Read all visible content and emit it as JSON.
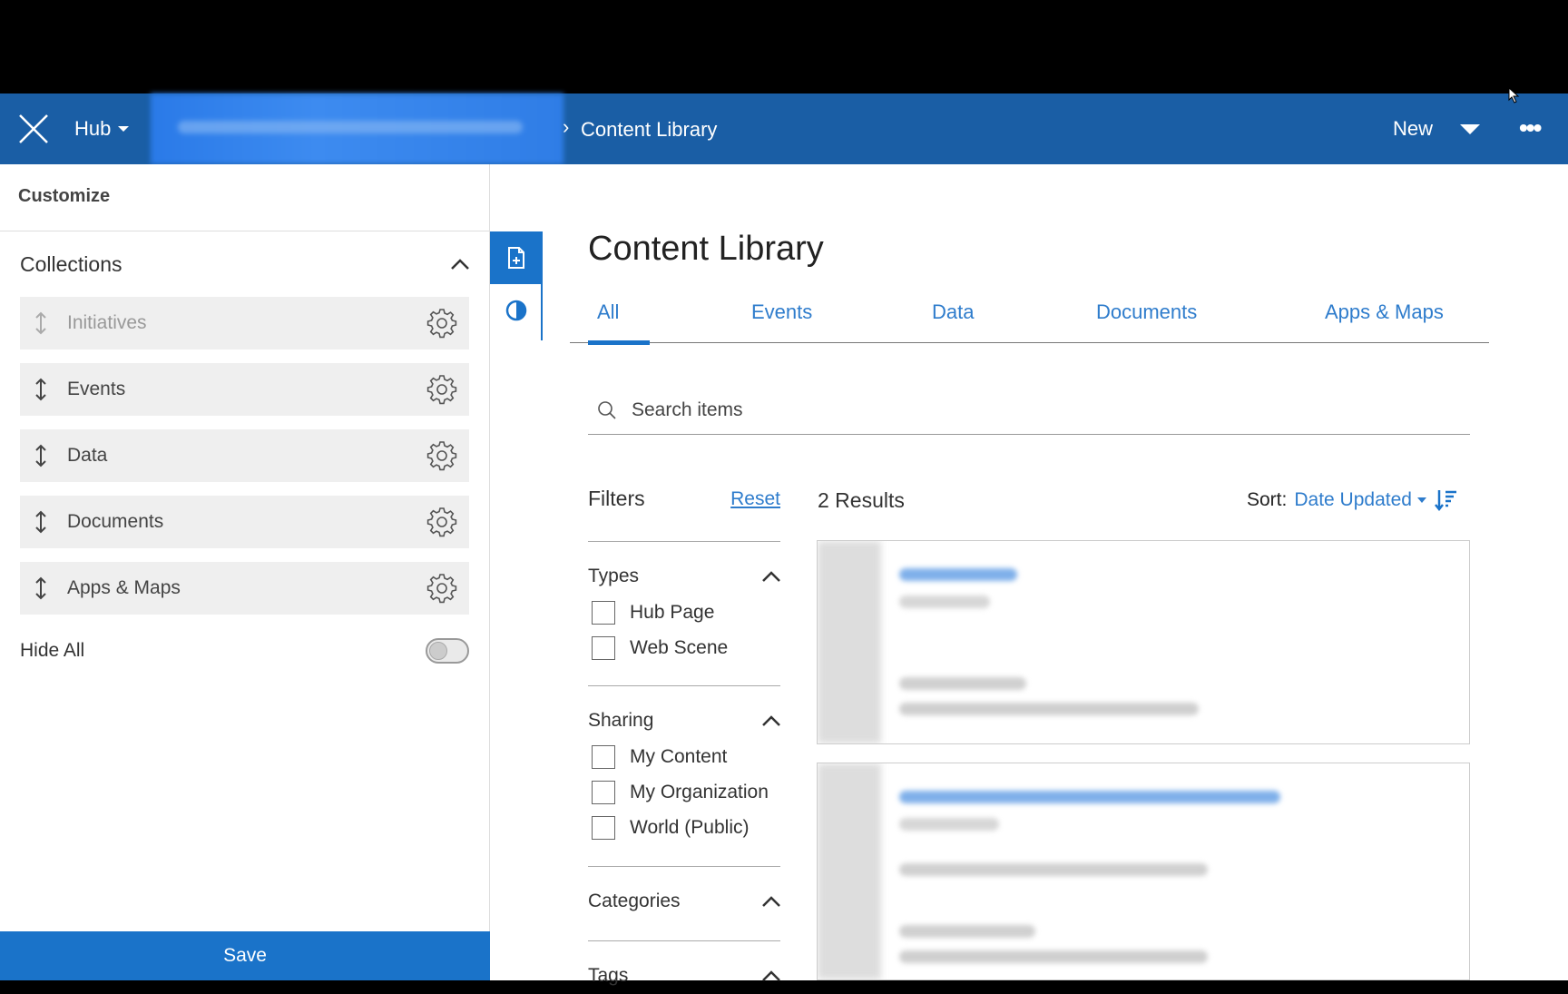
{
  "topbar": {
    "hub_label": "Hub",
    "crumb_separator": "›",
    "current_page": "Content Library",
    "new_label": "New",
    "more_label": "•••"
  },
  "sidepanel": {
    "header": "Customize",
    "collections_title": "Collections",
    "collections": [
      {
        "label": "Initiatives",
        "disabled": true
      },
      {
        "label": "Events",
        "disabled": false
      },
      {
        "label": "Data",
        "disabled": false
      },
      {
        "label": "Documents",
        "disabled": false
      },
      {
        "label": "Apps & Maps",
        "disabled": false
      }
    ],
    "hide_all_label": "Hide All",
    "hide_all_on": false,
    "save_label": "Save"
  },
  "main": {
    "title": "Content Library",
    "tabs": [
      {
        "label": "All",
        "active": true
      },
      {
        "label": "Events",
        "active": false
      },
      {
        "label": "Data",
        "active": false
      },
      {
        "label": "Documents",
        "active": false
      },
      {
        "label": "Apps & Maps",
        "active": false
      }
    ],
    "search_placeholder": "Search items",
    "filters_title": "Filters",
    "reset_label": "Reset",
    "results_count": "2 Results",
    "sort_label": "Sort:",
    "sort_value": "Date Updated",
    "filter_sections": {
      "types": {
        "title": "Types",
        "options": [
          "Hub Page",
          "Web Scene"
        ]
      },
      "sharing": {
        "title": "Sharing",
        "options": [
          "My Content",
          "My Organization",
          "World (Public)"
        ]
      },
      "categories": {
        "title": "Categories"
      },
      "tags": {
        "title": "Tags"
      }
    }
  },
  "colors": {
    "topbar": "#1a5ea5",
    "accent": "#1a73c9",
    "link": "#2e7ccc"
  }
}
